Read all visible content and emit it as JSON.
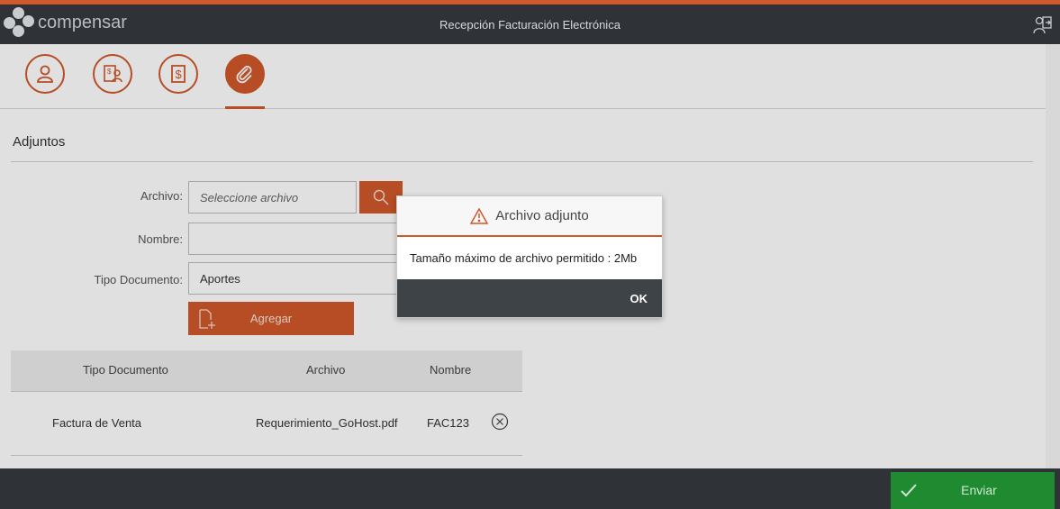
{
  "header": {
    "brand": "compensar",
    "title": "Recepción Facturación Electrónica"
  },
  "steps": [
    {
      "icon": "user-icon",
      "active": false
    },
    {
      "icon": "invoice-user-icon",
      "active": false
    },
    {
      "icon": "dollar-document-icon",
      "active": false
    },
    {
      "icon": "paperclip-icon",
      "active": true
    }
  ],
  "section": {
    "title": "Adjuntos"
  },
  "form": {
    "archivo_label": "Archivo:",
    "archivo_placeholder": "Seleccione archivo",
    "nombre_label": "Nombre:",
    "nombre_value": "",
    "tipo_label": "Tipo Documento:",
    "tipo_value": "Aportes",
    "add_label": "Agregar"
  },
  "table": {
    "headers": [
      "Tipo Documento",
      "Archivo",
      "Nombre"
    ],
    "rows": [
      {
        "tipo": "Factura de Venta",
        "archivo": "Requerimiento_GoHost.pdf",
        "nombre": "FAC123"
      }
    ]
  },
  "footer": {
    "send_label": "Enviar"
  },
  "modal": {
    "title": "Archivo adjunto",
    "message": "Tamaño máximo de archivo permitido : 2Mb",
    "ok_label": "OK"
  },
  "colors": {
    "accent": "#d0582a",
    "header": "#2f3236",
    "success": "#1f8a2f"
  }
}
